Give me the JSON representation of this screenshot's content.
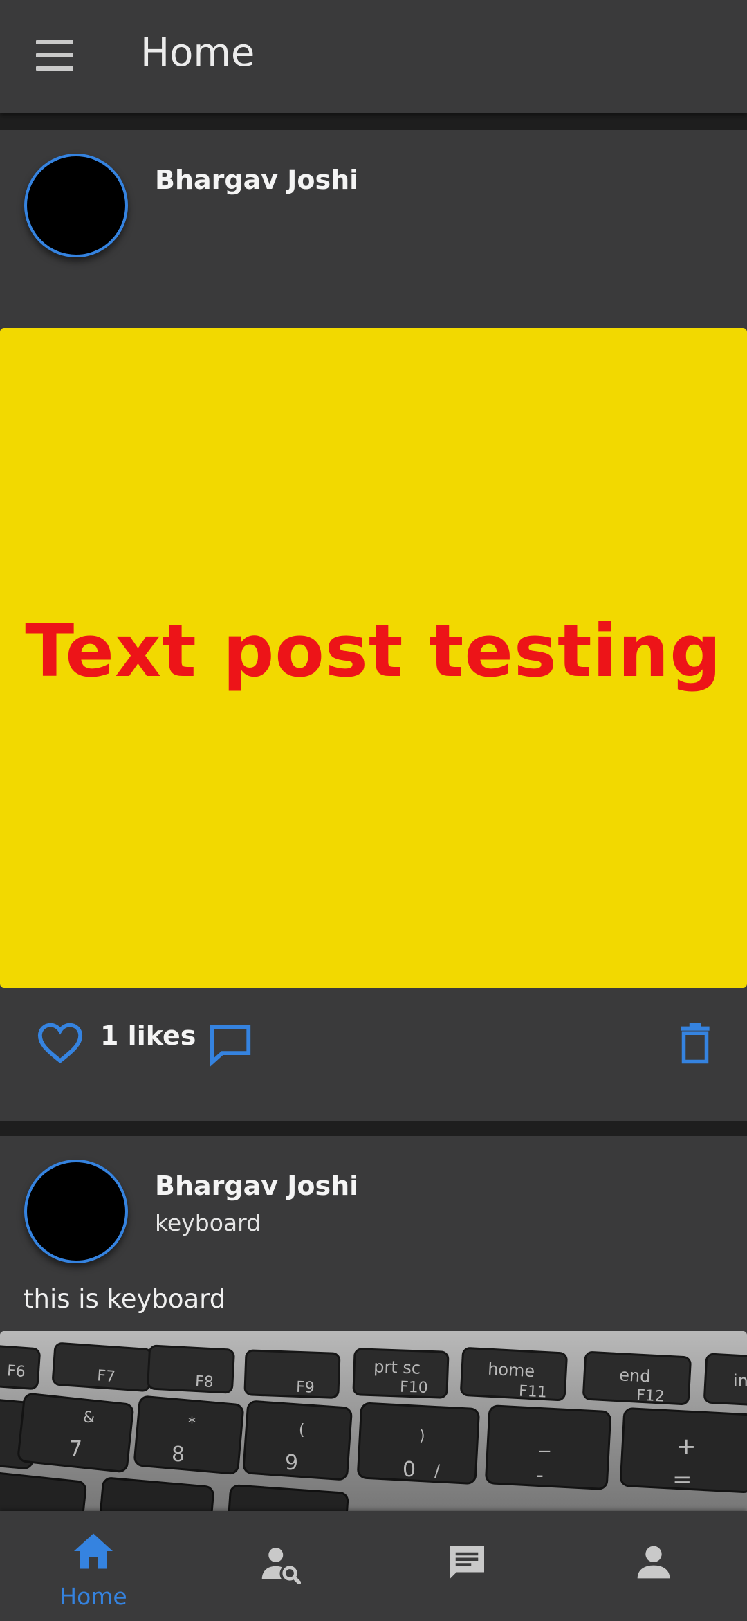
{
  "app_bar": {
    "title": "Home",
    "menu_icon": "menu-icon"
  },
  "colors": {
    "accent": "#3583e0",
    "surface": "#3a3a3b",
    "background": "#1e1e1e",
    "image_yellow": "#f2d900",
    "image_text_red": "#ed1418"
  },
  "posts": [
    {
      "author": "Bhargav Joshi",
      "image_text": "Text post testing",
      "likes_label": "1 likes",
      "like_icon": "heart-outline-icon",
      "comment_icon": "comment-outline-icon",
      "delete_icon": "trash-icon"
    },
    {
      "author": "Bhargav Joshi",
      "subtitle": "keyboard",
      "body": "this is keyboard",
      "keyboard_keys": {
        "row1": [
          "F6",
          "F7",
          "F8",
          "F9",
          "prt sc",
          "F10",
          "home",
          "F11",
          "end",
          "F12",
          "in"
        ],
        "row2": [
          "&",
          "7",
          "*",
          "8",
          "(",
          "9",
          ")",
          "0",
          "/",
          "_",
          "-",
          "+",
          "="
        ]
      }
    }
  ],
  "bottom_nav": {
    "items": [
      {
        "label": "Home",
        "icon": "home-icon",
        "active": true
      },
      {
        "icon": "user-search-icon"
      },
      {
        "icon": "chat-icon"
      },
      {
        "icon": "person-icon"
      }
    ]
  }
}
